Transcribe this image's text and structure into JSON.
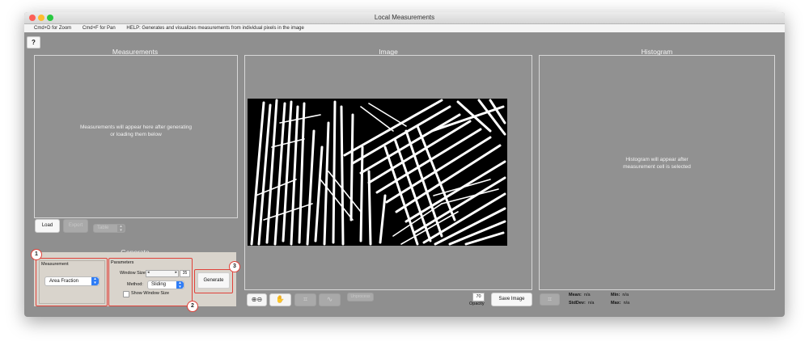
{
  "window": {
    "title": "Local Measurements"
  },
  "helpbar": {
    "zoom_hint": "Cmd+D for Zoom",
    "pan_hint": "Cmd+F for Pan",
    "help_text": "HELP:  Generates and visualizes measurements from individual pixels in the image"
  },
  "help_button": "?",
  "measurements": {
    "title": "Measurements",
    "placeholder": "Measurements will appear here after generating or loading them below",
    "load_label": "Load",
    "export_label": "Export",
    "format_select": "Table"
  },
  "generate": {
    "title": "Generate",
    "measurement_group": "Measurement",
    "measurement_value": "Area Fraction",
    "parameters_group": "Parameters",
    "window_size_label": "Window Size:",
    "window_size_value": "35",
    "method_label": "Method:",
    "method_value": "Sliding",
    "show_window_label": "Show Window Size",
    "generate_label": "Generate",
    "badges": [
      "1",
      "2",
      "3"
    ]
  },
  "image": {
    "title": "Image",
    "unprocess_label": "Unprocess",
    "opacity_value": "70",
    "opacity_label": "Opacity",
    "save_label": "Save Image",
    "tools": [
      "zoom-icon",
      "hand-icon",
      "crop-icon",
      "wave-icon"
    ]
  },
  "histogram": {
    "title": "Histogram",
    "placeholder": "Histogram will appear after measurement cell is selected",
    "mean_label": "Mean:",
    "mean_value": "n/a",
    "min_label": "Min:",
    "min_value": "n/a",
    "stddev_label": "StdDev:",
    "stddev_value": "n/a",
    "max_label": "Max:",
    "max_value": "n/a"
  }
}
